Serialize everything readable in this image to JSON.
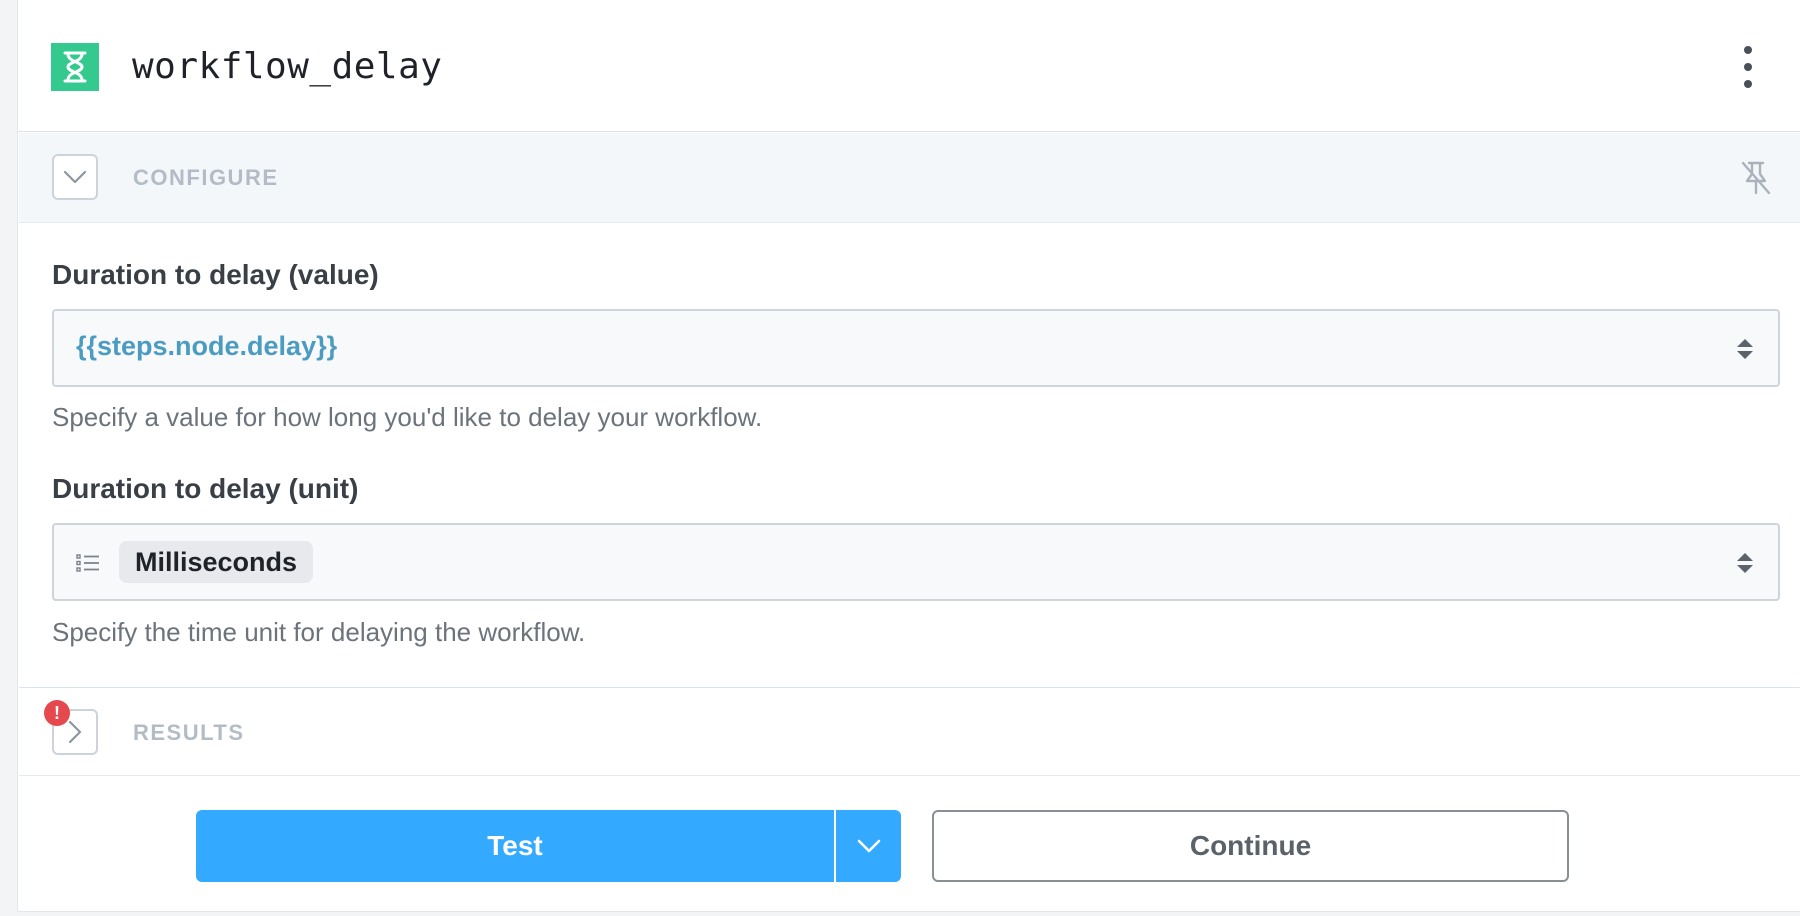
{
  "header": {
    "title": "workflow_delay",
    "app_icon": "hourglass-icon",
    "menu_icon": "more-vertical-icon"
  },
  "configure": {
    "label": "CONFIGURE",
    "toggle_icon": "chevron-down-icon",
    "pin_icon": "unpin-icon"
  },
  "fields": {
    "value": {
      "label": "Duration to delay (value)",
      "value": "{{steps.node.delay}}",
      "help": "Specify a value for how long you'd like to delay your workflow."
    },
    "unit": {
      "label": "Duration to delay (unit)",
      "value": "Milliseconds",
      "help": "Specify the time unit for delaying the workflow."
    }
  },
  "results": {
    "label": "RESULTS",
    "toggle_icon": "chevron-right-icon",
    "error_badge": "!"
  },
  "footer": {
    "test_label": "Test",
    "continue_label": "Continue"
  },
  "colors": {
    "app_icon_bg": "#34c98e",
    "primary": "#33aaff",
    "expression": "#4c9bc1",
    "error": "#e5484d"
  }
}
